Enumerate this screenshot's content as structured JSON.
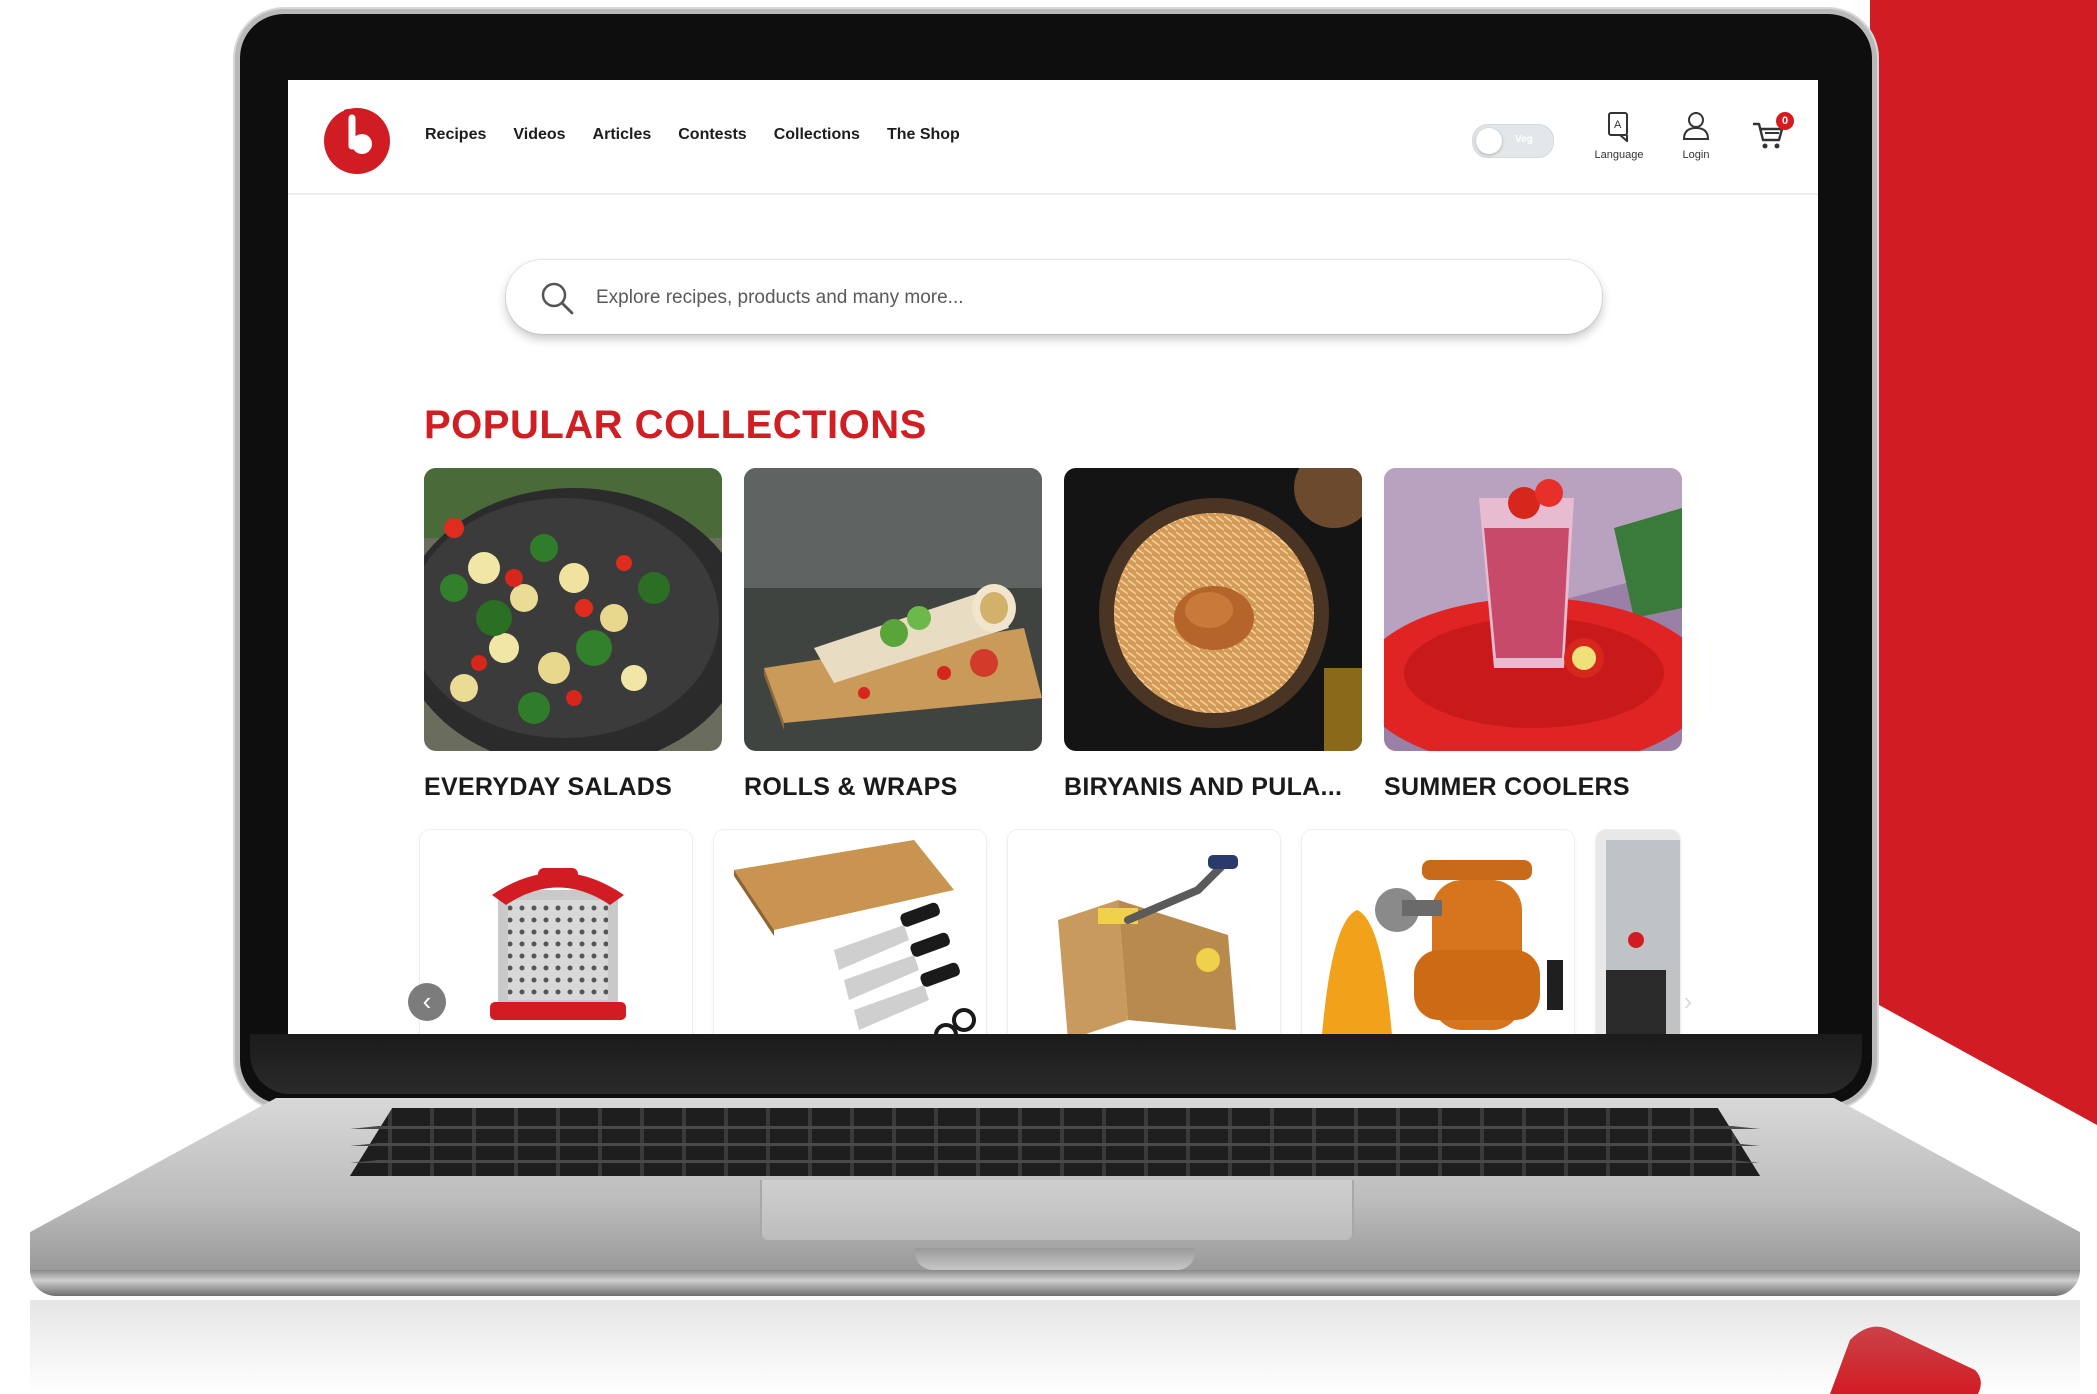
{
  "nav": {
    "items": [
      "Recipes",
      "Videos",
      "Articles",
      "Contests",
      "Collections",
      "The Shop"
    ]
  },
  "header": {
    "toggle_label": "Veg",
    "language_label": "Language",
    "login_label": "Login",
    "cart_count": "0"
  },
  "search": {
    "placeholder": "Explore recipes, products and many more..."
  },
  "main": {
    "section_title": "POPULAR COLLECTIONS",
    "collections": [
      {
        "title": "EVERYDAY SALADS"
      },
      {
        "title": "ROLLS & WRAPS"
      },
      {
        "title": "BIRYANIS AND PULA..."
      },
      {
        "title": "SUMMER COOLERS"
      }
    ],
    "products": [
      {
        "icon": "grater-icon"
      },
      {
        "icon": "knife-set-icon"
      },
      {
        "icon": "slicer-icon"
      },
      {
        "icon": "juicer-icon"
      },
      {
        "icon": "kitchen-tool-icon"
      }
    ]
  },
  "colors": {
    "brand_red": "#d01f23",
    "text_dark": "#1c1c1c"
  }
}
